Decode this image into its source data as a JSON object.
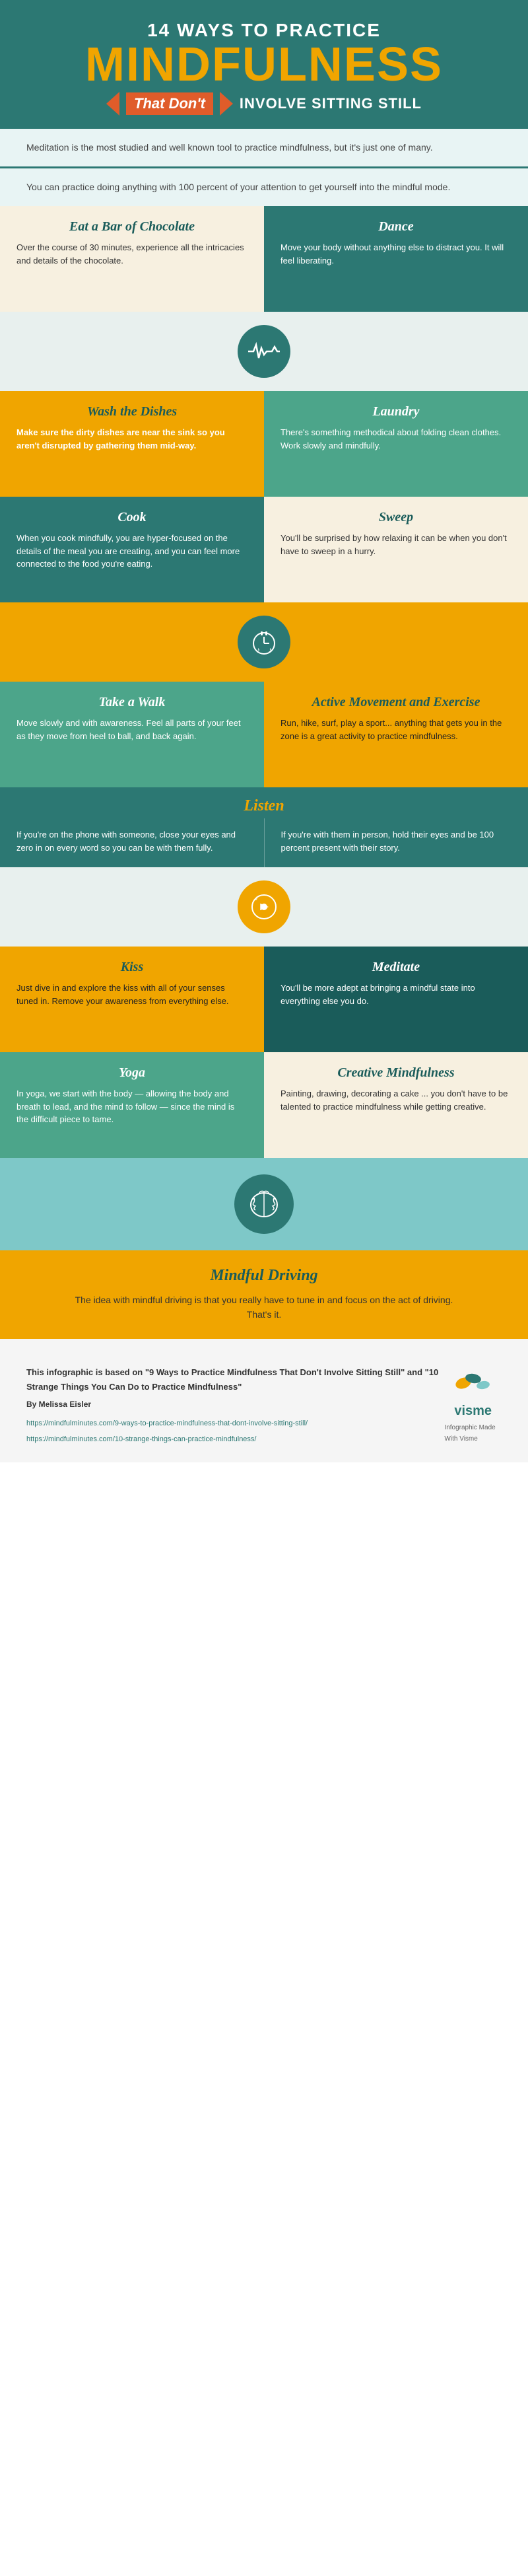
{
  "header": {
    "top_line": "14 WAYS TO PRACTICE",
    "main_title": "MINDFULNESS",
    "sub_dont": "That Don't",
    "sub_right": "INVOLVE SITTING STILL"
  },
  "info_boxes": {
    "box1": "Meditation is the most studied and well known tool to practice mindfulness, but it's just one of many.",
    "box2": "You can practice doing anything with 100 percent of your attention to get yourself into the mindful mode."
  },
  "items": {
    "eat_chocolate": {
      "title": "Eat a Bar of Chocolate",
      "text": "Over the course of 30 minutes, experience all the intricacies and details of the chocolate."
    },
    "dance": {
      "title": "Dance",
      "text": "Move your body without anything else to distract you. It will feel liberating."
    },
    "wash_dishes": {
      "title": "Wash the Dishes",
      "text": "Make sure the dirty dishes are near the sink so you aren't disrupted by gathering them mid-way."
    },
    "laundry": {
      "title": "Laundry",
      "text": "There's something methodical about folding clean clothes. Work slowly and mindfully."
    },
    "cook": {
      "title": "Cook",
      "text": "When you cook mindfully, you are hyper-focused on the details of the meal you are creating, and you can feel more connected to the food you're eating."
    },
    "sweep": {
      "title": "Sweep",
      "text": "You'll be surprised by how relaxing it can be when you don't have to sweep in a hurry."
    },
    "take_walk": {
      "title": "Take a Walk",
      "text": "Move slowly and with awareness. Feel all parts of your feet as they move from heel to ball, and back again."
    },
    "active_movement": {
      "title": "Active Movement and Exercise",
      "text": "Run, hike, surf, play a sport... anything that gets you in the zone is a great activity to practice mindfulness."
    },
    "listen": {
      "title": "Listen",
      "text_left": "If you're on the phone with someone, close your eyes and zero in on every word so you can be with them fully.",
      "text_right": "If you're with them in person, hold their eyes and be 100 percent present with their story."
    },
    "kiss": {
      "title": "Kiss",
      "text": "Just dive in and explore the kiss with all of your senses tuned in. Remove your awareness from everything else."
    },
    "meditate": {
      "title": "Meditate",
      "text": "You'll be more adept at bringing a mindful state into everything else you do."
    },
    "yoga": {
      "title": "Yoga",
      "text": "In yoga, we start with the body — allowing the body and breath to lead, and the mind to follow — since the mind is the difficult piece to tame."
    },
    "creative_mindfulness": {
      "title": "Creative Mindfulness",
      "text": "Painting, drawing, decorating a cake ... you don't have to be talented to practice mindfulness while getting creative."
    },
    "mindful_driving": {
      "title": "Mindful Driving",
      "text": "The idea with mindful driving is that you really have to tune in and focus on the act of driving. That's it."
    }
  },
  "footer": {
    "disclaimer": "This infographic is based on \"9 Ways to Practice Mindfulness That Don't Involve Sitting Still\" and \"10 Strange Things You Can Do to Practice Mindfulness\"",
    "author": "By Melissa Eisler",
    "links": [
      "https://mindfulminutes.com/9-ways-to-practice-mindfulness-that-dont-involve-sitting-still/",
      "https://mindfulminutes.com/10-strange-things-can-practice-mindfulness/"
    ],
    "visme_tagline": "Infographic Made With Visme",
    "visme_brand": "visme"
  }
}
